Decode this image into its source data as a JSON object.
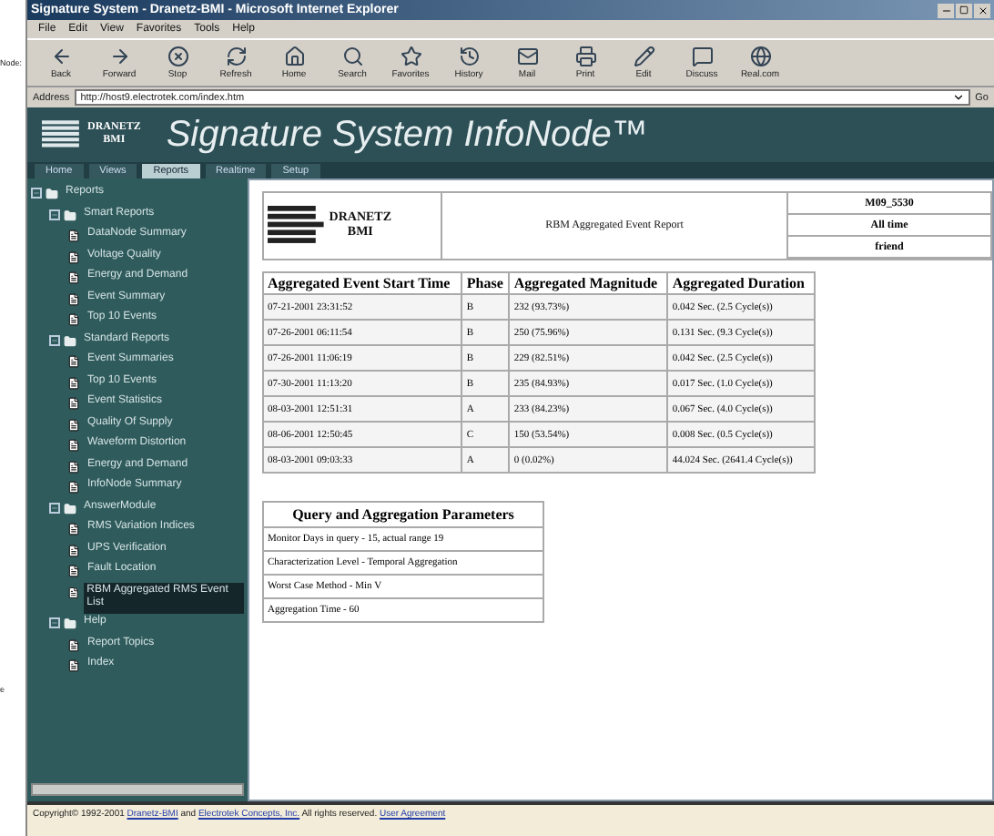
{
  "page_margin": {
    "fragments": [
      "Node:",
      "e"
    ]
  },
  "window": {
    "title": "Signature System - Dranetz-BMI - Microsoft Internet Explorer"
  },
  "menu": [
    "File",
    "Edit",
    "View",
    "Favorites",
    "Tools",
    "Help"
  ],
  "toolbar": [
    {
      "label": "Back",
      "kind": "back"
    },
    {
      "label": "Forward",
      "kind": "forward"
    },
    {
      "label": "Stop",
      "kind": "stop"
    },
    {
      "label": "Refresh",
      "kind": "refresh"
    },
    {
      "label": "Home",
      "kind": "home"
    },
    {
      "label": "Search",
      "kind": "search"
    },
    {
      "label": "Favorites",
      "kind": "favorites"
    },
    {
      "label": "History",
      "kind": "history"
    },
    {
      "label": "Mail",
      "kind": "mail"
    },
    {
      "label": "Print",
      "kind": "print"
    },
    {
      "label": "Edit",
      "kind": "edit"
    },
    {
      "label": "Discuss",
      "kind": "discuss"
    },
    {
      "label": "Real.com",
      "kind": "real"
    }
  ],
  "address": {
    "label": "Address",
    "value": "http://host9.electrotek.com/index.htm",
    "go": "Go"
  },
  "banner": {
    "logo_top": "DRANETZ",
    "logo_bottom": "BMI",
    "title": "Signature System InfoNode™"
  },
  "tabs": [
    {
      "label": "Home",
      "selected": false
    },
    {
      "label": "Views",
      "selected": false
    },
    {
      "label": "Reports",
      "selected": true
    },
    {
      "label": "Realtime",
      "selected": false
    },
    {
      "label": "Setup",
      "selected": false
    }
  ],
  "tree": [
    {
      "label": "Reports",
      "expanded": true,
      "children": [
        {
          "label": "Smart Reports",
          "expanded": true,
          "children": [
            {
              "label": "DataNode Summary",
              "selected": false
            },
            {
              "label": "Voltage Quality",
              "selected": false
            },
            {
              "label": "Energy and Demand",
              "selected": false
            },
            {
              "label": "Event Summary",
              "selected": false
            },
            {
              "label": "Top 10 Events",
              "selected": false
            }
          ]
        },
        {
          "label": "Standard Reports",
          "expanded": true,
          "children": [
            {
              "label": "Event Summaries",
              "selected": false
            },
            {
              "label": "Top 10 Events",
              "selected": false
            },
            {
              "label": "Event Statistics",
              "selected": false
            },
            {
              "label": "Quality Of Supply",
              "selected": false
            },
            {
              "label": "Waveform Distortion",
              "selected": false
            },
            {
              "label": "Energy and Demand",
              "selected": false
            },
            {
              "label": "InfoNode Summary",
              "selected": false
            }
          ]
        },
        {
          "label": "AnswerModule",
          "expanded": true,
          "children": [
            {
              "label": "RMS Variation Indices",
              "selected": false
            },
            {
              "label": "UPS Verification",
              "selected": false
            },
            {
              "label": "Fault Location",
              "selected": false
            },
            {
              "label": "RBM Aggregated RMS Event List",
              "selected": true
            }
          ]
        },
        {
          "label": "Help",
          "expanded": true,
          "children": [
            {
              "label": "Report Topics",
              "selected": false
            },
            {
              "label": "Index",
              "selected": false
            }
          ]
        }
      ]
    }
  ],
  "report": {
    "logo_top": "DRANETZ",
    "logo_bottom": "BMI",
    "title": "RBM Aggregated Event Report",
    "info": [
      "M09_5530",
      "All time",
      "friend"
    ],
    "columns": [
      "Aggregated Event Start Time",
      "Phase",
      "Aggregated Magnitude",
      "Aggregated Duration"
    ],
    "rows": [
      [
        "07-21-2001 23:31:52",
        "B",
        "232 (93.73%)",
        "0.042 Sec. (2.5 Cycle(s))"
      ],
      [
        "07-26-2001 06:11:54",
        "B",
        "250 (75.96%)",
        "0.131 Sec. (9.3 Cycle(s))"
      ],
      [
        "07-26-2001 11:06:19",
        "B",
        "229 (82.51%)",
        "0.042 Sec. (2.5 Cycle(s))"
      ],
      [
        "07-30-2001 11:13:20",
        "B",
        "235 (84.93%)",
        "0.017 Sec. (1.0 Cycle(s))"
      ],
      [
        "08-03-2001 12:51:31",
        "A",
        "233 (84.23%)",
        "0.067 Sec. (4.0 Cycle(s))"
      ],
      [
        "08-06-2001 12:50:45",
        "C",
        "150 (53.54%)",
        "0.008 Sec. (0.5 Cycle(s))"
      ],
      [
        "08-03-2001 09:03:33",
        "A",
        "0 (0.02%)",
        "44.024 Sec. (2641.4 Cycle(s))"
      ]
    ],
    "params_title": "Query and Aggregation Parameters",
    "params": [
      "Monitor Days in query - 15, actual range 19",
      "Characterization Level - Temporal Aggregation",
      "Worst Case Method - Min V",
      "Aggregation Time - 60"
    ]
  },
  "footer": {
    "prefix": "Copyright© 1992-2001",
    "link1": "Dranetz-BMI",
    "mid": "and",
    "link2": "Electrotek Concepts, Inc.",
    "rest": "All rights reserved.",
    "link3": "User Agreement"
  }
}
